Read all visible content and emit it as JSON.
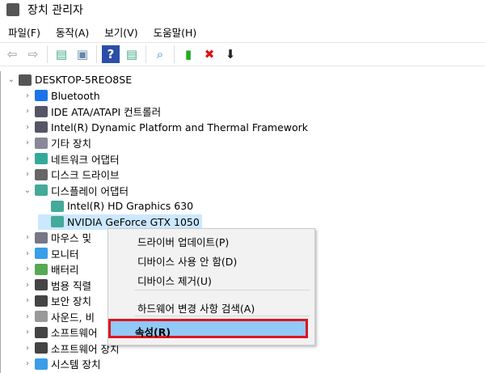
{
  "window": {
    "title": "장치 관리자"
  },
  "menubar": [
    "파일(F)",
    "동작(A)",
    "보기(V)",
    "도움말(H)"
  ],
  "toolbar": [
    {
      "icon": "back-icon",
      "glyph": "⇦",
      "color": "#999"
    },
    {
      "icon": "forward-icon",
      "glyph": "⇨",
      "color": "#999"
    },
    {
      "icon": "show-hide-tree-icon",
      "glyph": "▤",
      "color": "#4a8"
    },
    {
      "icon": "properties-icon",
      "glyph": "▣",
      "color": "#68a"
    },
    {
      "icon": "help-icon",
      "glyph": "?",
      "color": "#fff"
    },
    {
      "icon": "action-pane-icon",
      "glyph": "▤",
      "color": "#4a8"
    },
    {
      "icon": "scan-hardware-icon",
      "glyph": "⌕",
      "color": "#2a7ec0"
    },
    {
      "icon": "update-driver-icon",
      "glyph": "▮",
      "color": "#2a2"
    },
    {
      "icon": "uninstall-icon",
      "glyph": "✖",
      "color": "#e01010"
    },
    {
      "icon": "disable-icon",
      "glyph": "⬇",
      "color": "#222"
    }
  ],
  "tree": {
    "root": "DESKTOP-5REO8SE",
    "items": [
      {
        "label": "Bluetooth",
        "icon": "bluetooth-icon",
        "color": "#1a73e8",
        "level": 1
      },
      {
        "label": "IDE ATA/ATAPI 컨트롤러",
        "icon": "ide-icon",
        "color": "#556",
        "level": 1
      },
      {
        "label": "Intel(R) Dynamic Platform and Thermal Framework",
        "icon": "device-icon",
        "color": "#556",
        "level": 1
      },
      {
        "label": "기타 장치",
        "icon": "unknown-device-icon",
        "color": "#889",
        "level": 1
      },
      {
        "label": "네트워크 어댑터",
        "icon": "network-icon",
        "color": "#3a9",
        "level": 1
      },
      {
        "label": "디스크 드라이브",
        "icon": "disk-icon",
        "color": "#666",
        "level": 1
      },
      {
        "label": "디스플레이 어댑터",
        "icon": "display-adapter-icon",
        "color": "#4a9",
        "level": 1,
        "expanded": true
      },
      {
        "label": "Intel(R) HD Graphics 630",
        "icon": "display-adapter-icon",
        "color": "#4a9",
        "level": 2
      },
      {
        "label": "NVIDIA GeForce GTX 1050",
        "icon": "display-adapter-icon",
        "color": "#4a9",
        "level": 2,
        "selected": true
      },
      {
        "label": "마우스 및",
        "icon": "mouse-icon",
        "color": "#778",
        "level": 1
      },
      {
        "label": "모니터",
        "icon": "monitor-icon",
        "color": "#3a9ee8",
        "level": 1
      },
      {
        "label": "배터리",
        "icon": "battery-icon",
        "color": "#5a5",
        "level": 1
      },
      {
        "label": "범용 직렬",
        "icon": "usb-icon",
        "color": "#444",
        "level": 1
      },
      {
        "label": "보안 장치",
        "icon": "security-device-icon",
        "color": "#444",
        "level": 1
      },
      {
        "label": "사운드, 비",
        "icon": "sound-icon",
        "color": "#999",
        "level": 1
      },
      {
        "label": "소프트웨어",
        "icon": "software-component-icon",
        "color": "#444",
        "level": 1
      },
      {
        "label": "소프트웨어 장치",
        "icon": "software-device-icon",
        "color": "#444",
        "level": 1
      },
      {
        "label": "시스템 장치",
        "icon": "system-device-icon",
        "color": "#3a9ee8",
        "level": 1
      }
    ]
  },
  "context_menu": {
    "items": [
      "드라이버 업데이트(P)",
      "디바이스 사용 안 함(D)",
      "디바이스 제거(U)",
      "하드웨어 변경 사항 검색(A)"
    ],
    "highlighted": "속성(R)",
    "highlight_border": "#e0141e"
  }
}
